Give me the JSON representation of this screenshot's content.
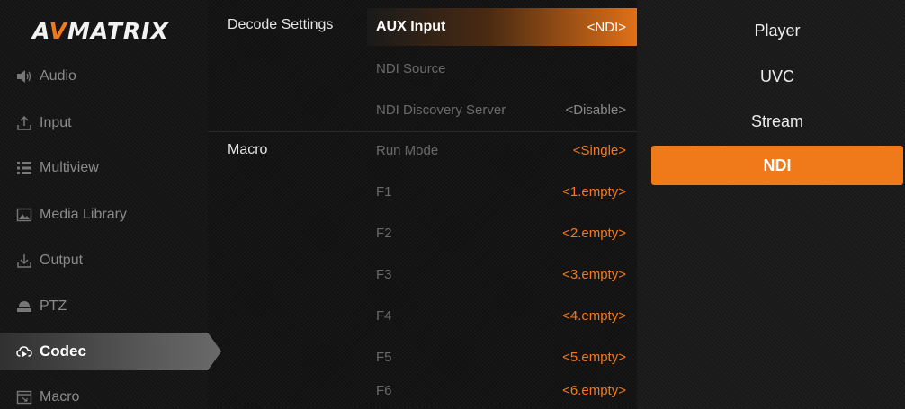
{
  "brand": {
    "logo_prefix": "A",
    "logo_accent": "V",
    "logo_suffix": "MATRIX",
    "accent_color": "#f07a1a"
  },
  "sidebar": {
    "items": [
      {
        "label": "Audio",
        "icon": "speaker-icon"
      },
      {
        "label": "Input",
        "icon": "upload-icon"
      },
      {
        "label": "Multiview",
        "icon": "list-icon"
      },
      {
        "label": "Media Library",
        "icon": "image-icon"
      },
      {
        "label": "Output",
        "icon": "download-icon"
      },
      {
        "label": "PTZ",
        "icon": "camera-icon"
      },
      {
        "label": "Codec",
        "icon": "cloud-icon",
        "active": true
      },
      {
        "label": "Macro",
        "icon": "macro-icon"
      }
    ]
  },
  "sections": {
    "decode": {
      "label": "Decode Settings",
      "rows": [
        {
          "name": "AUX Input",
          "value": "<NDI>"
        },
        {
          "name": "NDI Source",
          "value": ""
        },
        {
          "name": "NDI Discovery Server",
          "value": "<Disable>"
        }
      ]
    },
    "macro": {
      "label": "Macro",
      "rows": [
        {
          "name": "Run Mode",
          "value": "<Single>"
        },
        {
          "name": "F1",
          "value": "<1.empty>"
        },
        {
          "name": "F2",
          "value": "<2.empty>"
        },
        {
          "name": "F3",
          "value": "<3.empty>"
        },
        {
          "name": "F4",
          "value": "<4.empty>"
        },
        {
          "name": "F5",
          "value": "<5.empty>"
        },
        {
          "name": "F6",
          "value": "<6.empty>"
        }
      ]
    }
  },
  "options": {
    "items": [
      {
        "label": "Player"
      },
      {
        "label": "UVC"
      },
      {
        "label": "Stream"
      },
      {
        "label": "NDI",
        "selected": true
      }
    ]
  }
}
